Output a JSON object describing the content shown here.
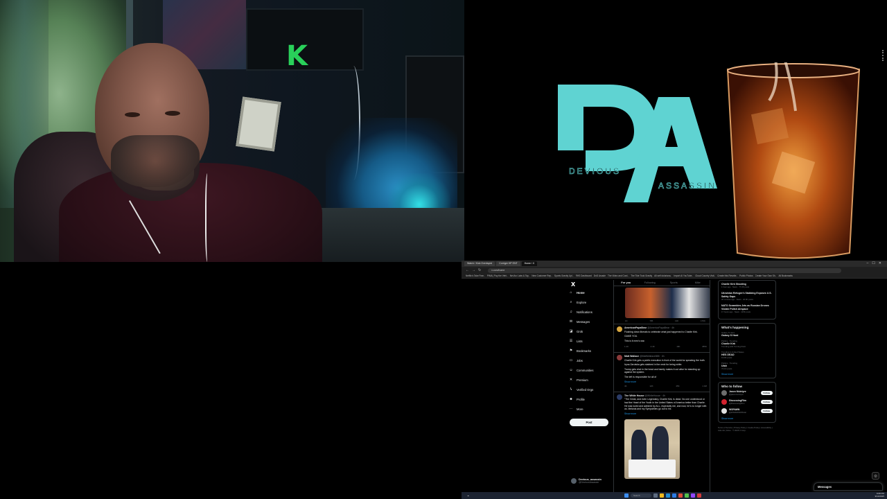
{
  "webcam": {
    "logo_letter": "K"
  },
  "brand": {
    "initials": "DA",
    "word_left": "DEVIOUS",
    "word_right": "ASSASSIN",
    "accent": "#5fd3d2"
  },
  "browser": {
    "tabs": [
      "Watch / Kick Overlayed",
      "Corriger HP ENT",
      "Home / X"
    ],
    "active_tab_index": 2,
    "url": "x.com/home",
    "bookmarks": [
      "Netflix's Take Fran..",
      "PIMA | Pay the Vehi..",
      "Net Arc Labs & Tay..",
      "New Customer Rep..",
      "Sports Gravity Upl..",
      "RHS Dashboard",
      "DnD Arcade",
      "The Video and Cord..",
      "The Tide Took Gravity",
      "All self doloriana..",
      "Import AI YouTube..",
      "Cloud Country Visit..",
      "Create this Rewrite..",
      "Public Photos",
      "Create Your Own Sh..",
      "All Bookmarks"
    ]
  },
  "x_nav": {
    "logo": "X",
    "items": [
      {
        "label": "Home",
        "icon": "home-icon",
        "glyph": "⌂",
        "bold": true
      },
      {
        "label": "Explore",
        "icon": "search-icon",
        "glyph": "⌕"
      },
      {
        "label": "Notifications",
        "icon": "bell-icon",
        "glyph": "♫"
      },
      {
        "label": "Messages",
        "icon": "mail-icon",
        "glyph": "✉"
      },
      {
        "label": "Grok",
        "icon": "grok-icon",
        "glyph": "◪"
      },
      {
        "label": "Lists",
        "icon": "list-icon",
        "glyph": "☰"
      },
      {
        "label": "Bookmarks",
        "icon": "bookmark-icon",
        "glyph": "⚑"
      },
      {
        "label": "Jobs",
        "icon": "briefcase-icon",
        "glyph": "▭"
      },
      {
        "label": "Communities",
        "icon": "people-icon",
        "glyph": "☺"
      },
      {
        "label": "Premium",
        "icon": "x-icon",
        "glyph": "✕"
      },
      {
        "label": "Verified Orgs",
        "icon": "lightning-icon",
        "glyph": "ϟ"
      },
      {
        "label": "Profile",
        "icon": "person-icon",
        "glyph": "☻"
      },
      {
        "label": "More",
        "icon": "more-icon",
        "glyph": "⋯"
      }
    ],
    "post_label": "Post",
    "account_name": "Devious_assassin",
    "account_handle": "@DeviousAssassin"
  },
  "feed": {
    "tabs": [
      "For you",
      "Following",
      "Sports",
      "Mike"
    ],
    "active_tab": 0,
    "top_stats": [
      "1K",
      "785",
      "13K",
      "176K"
    ],
    "tweets": [
      {
        "name": "AmericanPapaBear",
        "handle": "@AmericaPapaBear · 4h",
        "lines": [
          "Flushing down liberals to celebrate what just happened to Charlie Kirk.",
          "GAME YOU.",
          "This is it men's war."
        ],
        "stats": [
          "1.2K",
          "4.4K",
          "16K",
          "455K"
        ],
        "avatar": "#d7a640"
      },
      {
        "name": "Matt Wallace",
        "handle": "@MattWallace888 · 4h",
        "lines": [
          "Charlie Kirk gets a public execution in front of the world for speaking the truth.",
          "Iryna Zarutska gets stabbed in the neck for being white.",
          "Trump gets shot in the head and barely makes it out alive for standing up against the system.",
          "The left is responsible for all of"
        ],
        "more": "Show more",
        "stats": [
          "4K",
          "12K",
          "45K",
          "1.4M"
        ],
        "avatar": "#8a3a3a"
      },
      {
        "name": "The White House",
        "handle": "@WhiteHouse · 4h",
        "lines": [
          "\"The Great, and even Legendary, Charlie Kirk, is dead. No one understood or had the Heart of the Youth in the United States of America better than Charlie. He was loved and admired by ALL, especially me, and now, he's no longer with us. Melania and my Sympathies go out to his"
        ],
        "more": "Show more",
        "avatar": "#2b3b66"
      }
    ]
  },
  "right_sidebar": {
    "news_top": [
      {
        "title": "Charlie Kirk Shooting",
        "meta": "1 hour ago · News · 77.2K posts"
      },
      {
        "title": "Ukrainian Refugee's Stabbing Exposes U.S. Safety Gaps",
        "meta": "20 minutes ago · News · 20.6K posts"
      },
      {
        "title": "NATO Scrambles Jets as Russian Drones Violate Polish Airspace",
        "meta": "17 hours ago · News · 115K posts"
      }
    ],
    "happening_title": "What's happening",
    "trends": [
      {
        "meta": "Galaxy S Hard",
        "title": "Galaxy S Hard",
        "sub": ""
      },
      {
        "meta": "Politics · Trending",
        "title": "Charlie Kirk",
        "sub": "Trending with Turning Point"
      },
      {
        "meta": "Trending in United States",
        "title": "HES DEAD",
        "sub": "19.9K posts"
      },
      {
        "meta": "Politics · Trending",
        "title": "Utah",
        "sub": "72.1K posts"
      }
    ],
    "show_more": "Show more",
    "follow_title": "Who to follow",
    "follow": [
      {
        "name": "Jason McIntyre",
        "handle": "@jasonmcintyre",
        "btn": "Follow",
        "avatar": "#6d6d6d"
      },
      {
        "name": "DiscussingFilm",
        "handle": "@DiscussingFilm",
        "btn": "Follow",
        "avatar": "#d3222e"
      },
      {
        "name": "WSPAWN",
        "handle": "@WSPAWNOfficial",
        "btn": "Follow",
        "avatar": "#e0e0e0"
      }
    ],
    "follow_more": "Show more",
    "footer": "Terms of Service | Privacy Policy | Cookie Policy | Accessibility | Ads info | More · © 2025 X Corp."
  },
  "messages_drawer": "Messages",
  "taskbar": {
    "search": "Search",
    "time": "9:08 PM",
    "date": "9/10/2025"
  }
}
